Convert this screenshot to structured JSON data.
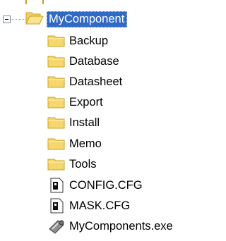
{
  "tree": {
    "root": {
      "label": "MyComponent",
      "expanded": true,
      "selected": true,
      "icon": "folder-open-icon",
      "expander_icon": "collapse-minus-icon"
    },
    "children": [
      {
        "label": "Backup",
        "icon": "folder-icon"
      },
      {
        "label": "Database",
        "icon": "folder-icon"
      },
      {
        "label": "Datasheet",
        "icon": "folder-icon"
      },
      {
        "label": "Export",
        "icon": "folder-icon"
      },
      {
        "label": "Install",
        "icon": "folder-icon"
      },
      {
        "label": "Memo",
        "icon": "folder-icon"
      },
      {
        "label": "Tools",
        "icon": "folder-icon"
      },
      {
        "label": "CONFIG.CFG",
        "icon": "config-file-icon"
      },
      {
        "label": "MASK.CFG",
        "icon": "config-file-icon"
      },
      {
        "label": "MyComponents.exe",
        "icon": "executable-icon"
      }
    ]
  },
  "colors": {
    "selection": "#316ac5",
    "folder": "#f5d76e",
    "folder_outline": "#c9a227"
  }
}
